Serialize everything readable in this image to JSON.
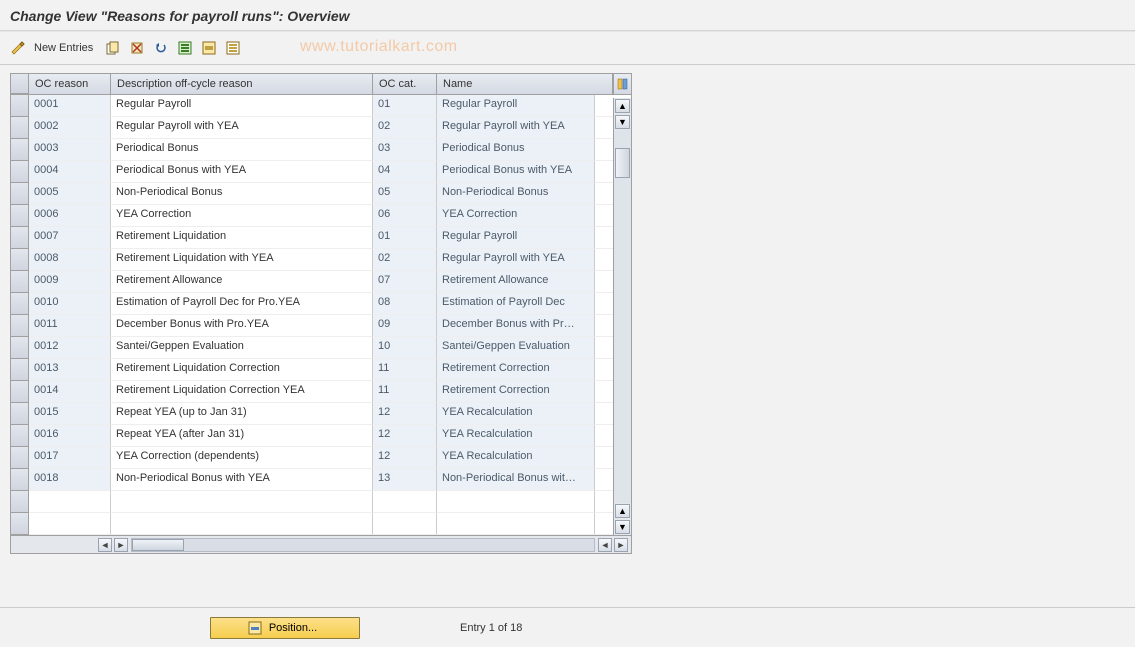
{
  "title": "Change View \"Reasons for payroll runs\": Overview",
  "toolbar": {
    "new_entries_label": "New Entries"
  },
  "watermark": "www.tutorialkart.com",
  "columns": {
    "oc_reason": "OC reason",
    "description": "Description off-cycle reason",
    "oc_cat": "OC cat.",
    "name": "Name"
  },
  "rows": [
    {
      "reason": "0001",
      "desc": "Regular Payroll",
      "cat": "01",
      "name": "Regular Payroll"
    },
    {
      "reason": "0002",
      "desc": "Regular Payroll with YEA",
      "cat": "02",
      "name": "Regular Payroll with YEA"
    },
    {
      "reason": "0003",
      "desc": "Periodical Bonus",
      "cat": "03",
      "name": "Periodical Bonus"
    },
    {
      "reason": "0004",
      "desc": "Periodical Bonus with YEA",
      "cat": "04",
      "name": "Periodical Bonus with YEA"
    },
    {
      "reason": "0005",
      "desc": "Non-Periodical Bonus",
      "cat": "05",
      "name": "Non-Periodical Bonus"
    },
    {
      "reason": "0006",
      "desc": "YEA Correction",
      "cat": "06",
      "name": "YEA Correction"
    },
    {
      "reason": "0007",
      "desc": "Retirement Liquidation",
      "cat": "01",
      "name": "Regular Payroll"
    },
    {
      "reason": "0008",
      "desc": "Retirement Liquidation with YEA",
      "cat": "02",
      "name": "Regular Payroll with YEA"
    },
    {
      "reason": "0009",
      "desc": "Retirement Allowance",
      "cat": "07",
      "name": "Retirement Allowance"
    },
    {
      "reason": "0010",
      "desc": "Estimation of Payroll Dec for Pro.YEA",
      "cat": "08",
      "name": "Estimation of Payroll Dec"
    },
    {
      "reason": "0011",
      "desc": "December Bonus with Pro.YEA",
      "cat": "09",
      "name": "December Bonus with Pr…"
    },
    {
      "reason": "0012",
      "desc": "Santei/Geppen Evaluation",
      "cat": "10",
      "name": "Santei/Geppen Evaluation"
    },
    {
      "reason": "0013",
      "desc": "Retirement Liquidation Correction",
      "cat": "11",
      "name": "Retirement Correction"
    },
    {
      "reason": "0014",
      "desc": "Retirement Liquidation Correction YEA",
      "cat": "11",
      "name": "Retirement Correction"
    },
    {
      "reason": "0015",
      "desc": "Repeat YEA (up to Jan 31)",
      "cat": "12",
      "name": "YEA Recalculation"
    },
    {
      "reason": "0016",
      "desc": "Repeat YEA (after Jan 31)",
      "cat": "12",
      "name": "YEA Recalculation"
    },
    {
      "reason": "0017",
      "desc": "YEA Correction (dependents)",
      "cat": "12",
      "name": "YEA Recalculation"
    },
    {
      "reason": "0018",
      "desc": "Non-Periodical Bonus with YEA",
      "cat": "13",
      "name": "Non-Periodical Bonus wit…"
    }
  ],
  "footer": {
    "position_label": "Position...",
    "status": "Entry 1 of 18"
  }
}
